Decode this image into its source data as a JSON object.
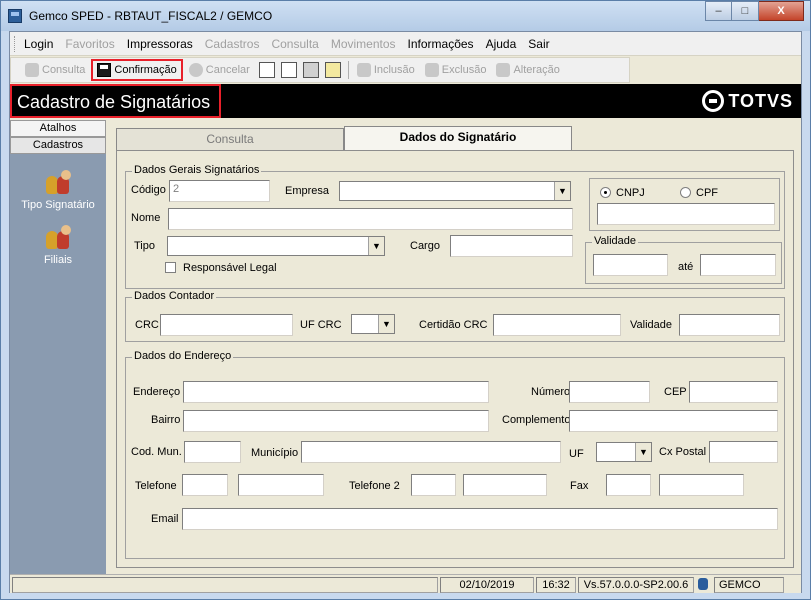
{
  "window": {
    "title": "Gemco SPED - RBTAUT_FISCAL2 / GEMCO",
    "min": "–",
    "max": "□",
    "close": "X"
  },
  "menu": {
    "items": [
      {
        "label": "Login",
        "enabled": true
      },
      {
        "label": "Favoritos",
        "enabled": false
      },
      {
        "label": "Impressoras",
        "enabled": true
      },
      {
        "label": "Cadastros",
        "enabled": false
      },
      {
        "label": "Consulta",
        "enabled": false
      },
      {
        "label": "Movimentos",
        "enabled": false
      },
      {
        "label": "Informações",
        "enabled": true
      },
      {
        "label": "Ajuda",
        "enabled": true
      },
      {
        "label": "Sair",
        "enabled": true
      }
    ]
  },
  "toolbar": {
    "consulta": "Consulta",
    "confirmacao": "Confirmação",
    "cancelar": "Cancelar",
    "inclusao": "Inclusão",
    "exclusao": "Exclusão",
    "alteracao": "Alteração"
  },
  "header": {
    "title": "Cadastro de Signatários",
    "logo": "TOTVS"
  },
  "left_panel": {
    "tabs": [
      "Atalhos",
      "Cadastros"
    ],
    "items": [
      "Tipo Signatário",
      "Filiais"
    ]
  },
  "tabs": [
    "Consulta",
    "Dados do Signatário"
  ],
  "dados_gerais": {
    "title": "Dados Gerais Signatários",
    "codigo_label": "Código",
    "codigo_value": "2",
    "empresa_label": "Empresa",
    "nome_label": "Nome",
    "tipo_label": "Tipo",
    "cargo_label": "Cargo",
    "responsavel_label": "Responsável Legal",
    "cnpj_label": "CNPJ",
    "cpf_label": "CPF",
    "validade_title": "Validade",
    "ate_label": "até"
  },
  "dados_contador": {
    "title": "Dados Contador",
    "crc_label": "CRC",
    "uf_crc_label": "UF CRC",
    "certidao_label": "Certidão CRC",
    "validade_label": "Validade"
  },
  "dados_endereco": {
    "title": "Dados do Endereço",
    "endereco_label": "Endereço",
    "numero_label": "Número",
    "cep_label": "CEP",
    "bairro_label": "Bairro",
    "complemento_label": "Complemento",
    "cod_mun_label": "Cod. Mun.",
    "municipio_label": "Município",
    "uf_label": "UF",
    "cx_postal_label": "Cx Postal",
    "telefone_label": "Telefone",
    "telefone2_label": "Telefone 2",
    "fax_label": "Fax",
    "email_label": "Email"
  },
  "status": {
    "date": "02/10/2019",
    "time": "16:32",
    "version": "Vs.57.0.0.0-SP2.00.6",
    "user": "GEMCO"
  }
}
